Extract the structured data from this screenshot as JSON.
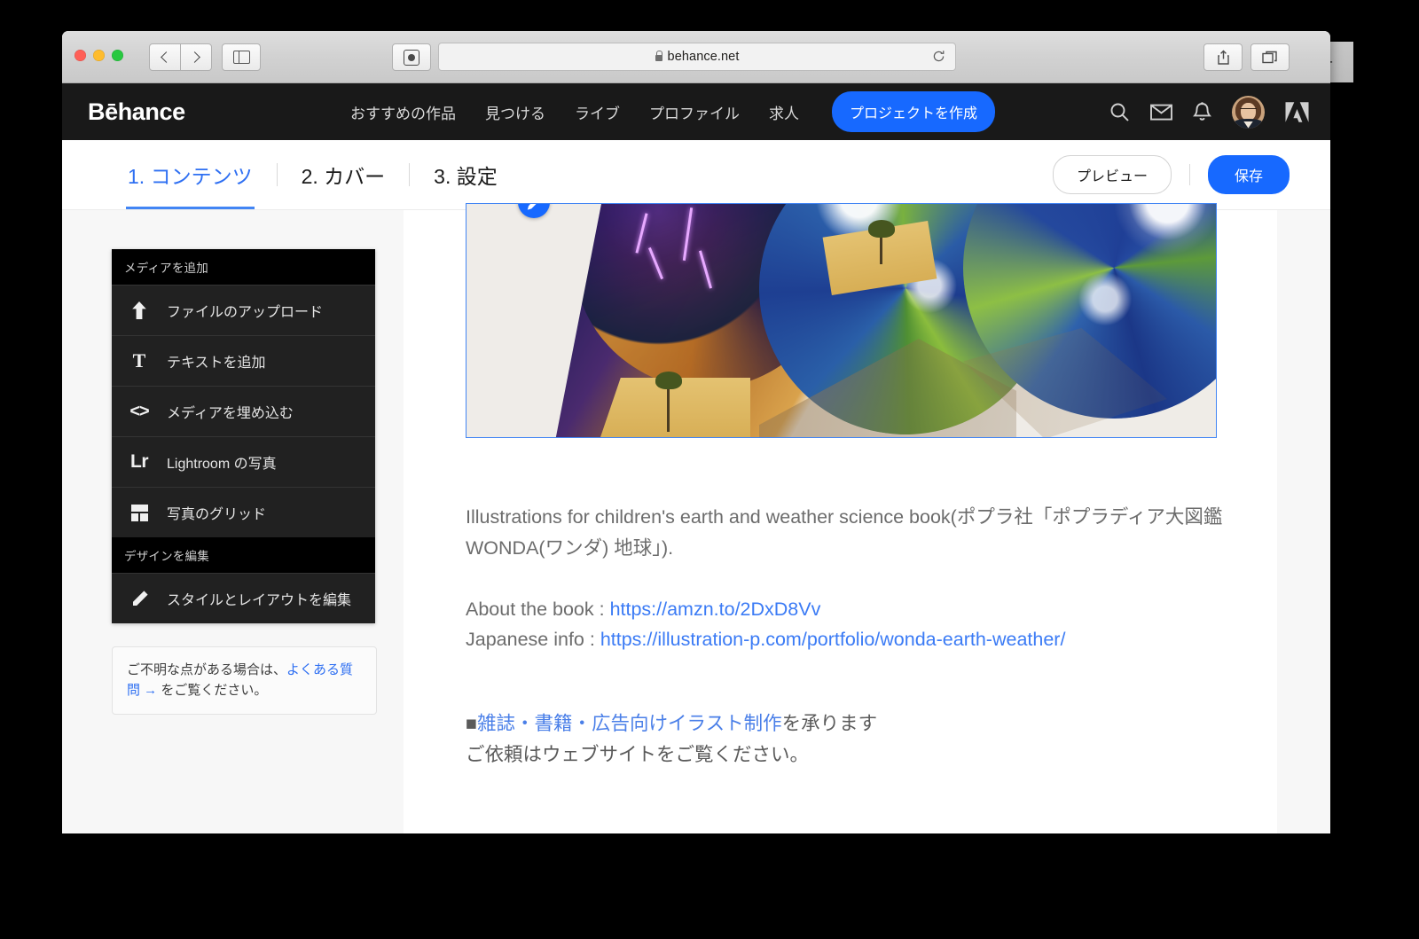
{
  "browser": {
    "url": "behance.net",
    "lock_icon": "lock-icon",
    "back_icon": "chevron-left-icon",
    "forward_icon": "chevron-right-icon",
    "sidebar_icon": "sidebar-toggle-icon",
    "reader_icon": "reader-view-icon",
    "reload_icon": "reload-icon",
    "share_icon": "share-icon",
    "tabs_icon": "show-tabs-icon",
    "newtab_label": "+"
  },
  "header": {
    "logo": "Bēhance",
    "nav": [
      {
        "label": "おすすめの作品"
      },
      {
        "label": "見つける"
      },
      {
        "label": "ライブ"
      },
      {
        "label": "プロファイル"
      },
      {
        "label": "求人"
      }
    ],
    "create_button": "プロジェクトを作成",
    "icons": [
      "search-icon",
      "mail-icon",
      "bell-icon",
      "avatar",
      "adobe-logo"
    ],
    "bg_color": "#191919",
    "accent_color": "#1769ff"
  },
  "editor": {
    "steps": [
      {
        "label": "1. コンテンツ",
        "active": true
      },
      {
        "label": "2. カバー",
        "active": false
      },
      {
        "label": "3. 設定",
        "active": false
      }
    ],
    "preview_button": "プレビュー",
    "save_button": "保存",
    "active_color": "#2e6ff2"
  },
  "sidebar": {
    "sections": [
      {
        "title": "メディアを追加",
        "items": [
          {
            "label": "ファイルのアップロード",
            "icon": "upload-arrow-icon"
          },
          {
            "label": "テキストを追加",
            "icon": "text-t-icon"
          },
          {
            "label": "メディアを埋め込む",
            "icon": "embed-code-icon"
          },
          {
            "label": "Lightroom の写真",
            "icon": "lightroom-icon"
          },
          {
            "label": "写真のグリッド",
            "icon": "photo-grid-icon"
          }
        ]
      },
      {
        "title": "デザインを編集",
        "items": [
          {
            "label": "スタイルとレイアウトを編集",
            "icon": "pencil-icon"
          }
        ]
      }
    ],
    "help": {
      "prefix": "ご不明な点がある場合は、",
      "link": "よくある質問 →",
      "suffix": " をご覧ください。"
    }
  },
  "content": {
    "image_block": {
      "alt": "earth-and-weather-science-book-photo",
      "edit_badge_icon": "pencil-icon",
      "selected": true
    },
    "paragraph1": "Illustrations for children's earth and weather science book(ポプラ社「ポプラディア大図鑑 WONDA(ワンダ) 地球」).",
    "about_label": "About the book : ",
    "about_url": "https://amzn.to/2DxD8Vv",
    "japanese_label": "Japanese info : ",
    "japanese_url": "https://illustration-p.com/portfolio/wonda-earth-weather/",
    "promo_bullet": "■",
    "promo_link": "雑誌・書籍・広告向けイラスト制作",
    "promo_tail": "を承ります",
    "promo_line2": "ご依頼はウェブサイトをご覧ください。"
  }
}
